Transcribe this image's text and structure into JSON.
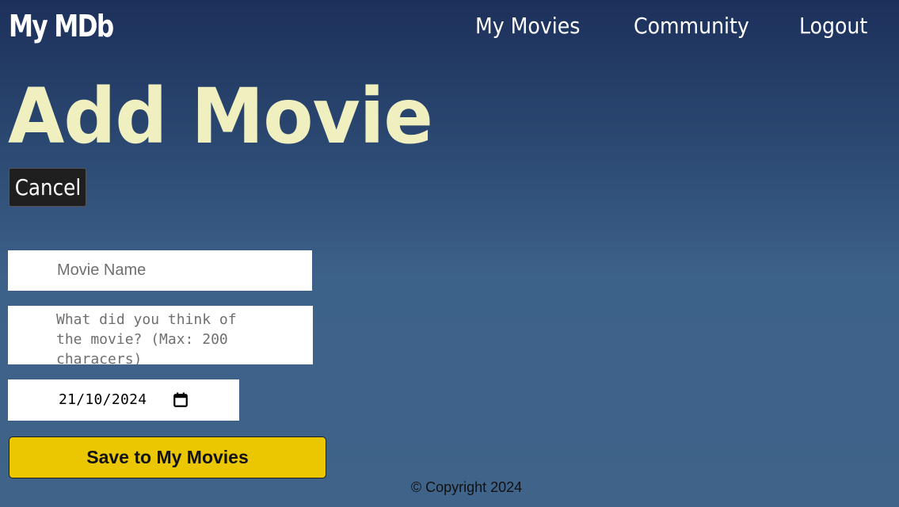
{
  "header": {
    "logo": "My MDb",
    "nav": {
      "my_movies": "My Movies",
      "community": "Community",
      "logout": "Logout"
    }
  },
  "main": {
    "title": "Add Movie",
    "cancel_label": "Cancel",
    "form": {
      "movie_name_placeholder": "Movie Name",
      "movie_name_value": "",
      "review_placeholder": "What did you think of the movie? (Max: 200 characers)",
      "review_value": "",
      "date_value": "21/10/2024",
      "save_label": "Save to My Movies"
    }
  },
  "footer": {
    "copyright": "© Copyright 2024"
  },
  "colors": {
    "background_top": "#1c305a",
    "background_bottom": "#3f6389",
    "title": "#efefbf",
    "save_button": "#eac700",
    "cancel_button": "#1f1f1f"
  },
  "icons": {
    "date_picker": "calendar-icon"
  }
}
